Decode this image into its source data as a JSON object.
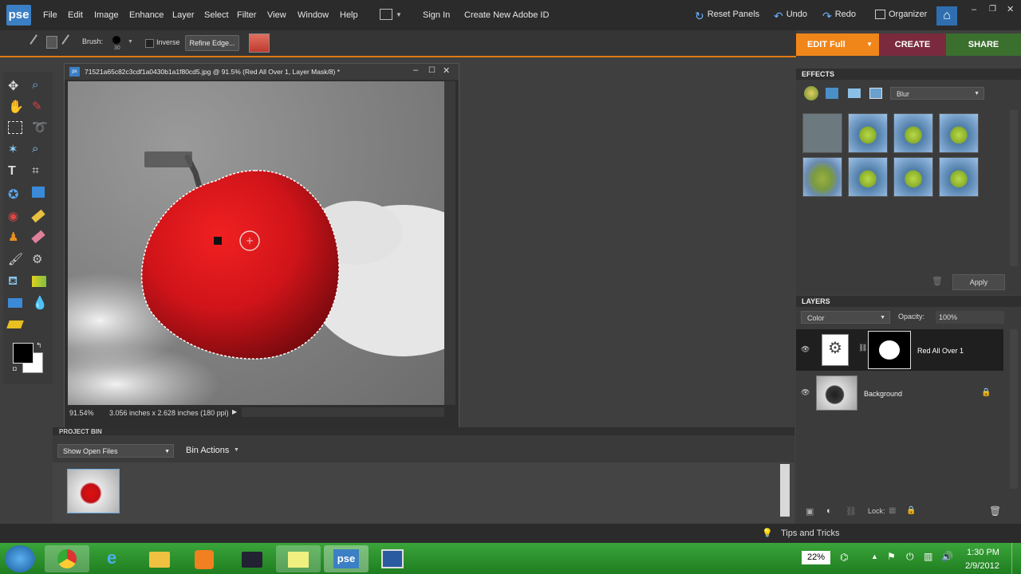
{
  "app": {
    "logo": "pse"
  },
  "menu": [
    "File",
    "Edit",
    "Image",
    "Enhance",
    "Layer",
    "Select",
    "Filter",
    "View",
    "Window",
    "Help"
  ],
  "topbar": {
    "sign_in": "Sign In",
    "create_id": "Create New Adobe ID",
    "reset_panels": "Reset Panels",
    "undo": "Undo",
    "redo": "Redo",
    "organizer": "Organizer"
  },
  "options": {
    "brush_label": "Brush:",
    "brush_size": "30",
    "inverse_label": "Inverse",
    "refine_edge": "Refine Edge..."
  },
  "modes": {
    "edit": "EDIT Full",
    "create": "CREATE",
    "share": "SHARE"
  },
  "document": {
    "title": "71521a65c82c3cdf1a0430b1a1f80cd5.jpg @ 91.5% (Red All Over 1, Layer Mask/8) *",
    "zoom": "91.54%",
    "info": "3.056 inches x 2.628 inches (180 ppi)"
  },
  "bin": {
    "title": "PROJECT BIN",
    "show_files": "Show Open Files",
    "bin_actions": "Bin Actions"
  },
  "effects": {
    "title": "EFFECTS",
    "category": "Blur",
    "apply": "Apply"
  },
  "layers": {
    "title": "LAYERS",
    "blend": "Color",
    "opacity_label": "Opacity:",
    "opacity": "100%",
    "lock_label": "Lock:",
    "items": [
      {
        "name": "Red All Over 1"
      },
      {
        "name": "Background"
      }
    ]
  },
  "tips": "Tips and Tricks",
  "taskbar": {
    "battery": "22%",
    "time": "1:30 PM",
    "date": "2/9/2012"
  },
  "colors": {
    "accent": "#e07a12",
    "edit_mode": "#f0861a",
    "create_mode": "#7a2a3c",
    "share_mode": "#3b6f2e",
    "apple": "#d8141a"
  }
}
